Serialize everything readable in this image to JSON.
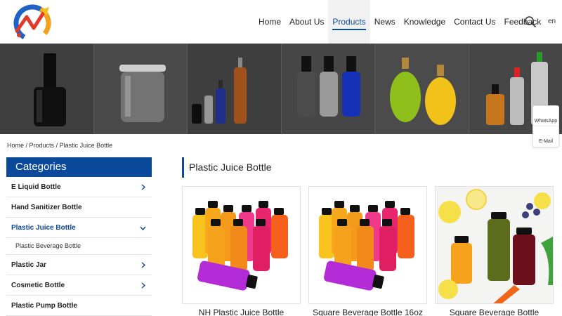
{
  "header": {
    "nav": [
      "Home",
      "About Us",
      "Products",
      "News",
      "Knowledge",
      "Contact Us",
      "Feedback"
    ],
    "active_index": 2,
    "lang": "en"
  },
  "side_float": {
    "whatsapp": "WhatsApp",
    "email": "E-Mail"
  },
  "breadcrumb": {
    "home": "Home",
    "products": "Products",
    "current": "Plastic Juice Bottle",
    "sep": " / "
  },
  "sidebar": {
    "title": "Categories",
    "items": [
      {
        "label": "E Liquid Bottle",
        "chevron": "right"
      },
      {
        "label": "Hand Sanitizer Bottle",
        "chevron": ""
      },
      {
        "label": "Plastic Juice Bottle",
        "chevron": "down",
        "active": true,
        "sub": [
          "Plastic Beverage Bottle"
        ]
      },
      {
        "label": "Plastic Jar",
        "chevron": "right"
      },
      {
        "label": "Cosmetic Bottle",
        "chevron": "right"
      },
      {
        "label": "Plastic Pump Bottle",
        "chevron": ""
      }
    ]
  },
  "main": {
    "title": "Plastic Juice Bottle",
    "products": [
      {
        "title": "NH Plastic Juice Bottle"
      },
      {
        "title": "Square Beverage Bottle 16oz"
      },
      {
        "title": "Square Beverage Bottle"
      }
    ]
  },
  "colors": {
    "brand": "#0b4a9a",
    "banner_dark": "#3d3d3d"
  }
}
